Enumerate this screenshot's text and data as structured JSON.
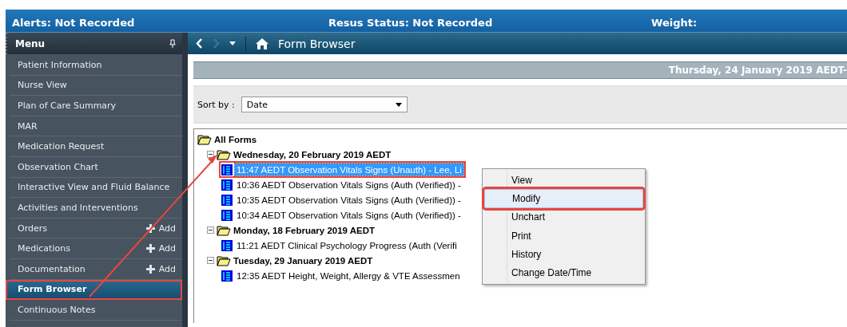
{
  "banner": {
    "alerts": "Alerts: Not Recorded",
    "resus": "Resus Status: Not Recorded",
    "weight": "Weight:"
  },
  "menu_header": {
    "title": "Menu"
  },
  "sidebar": {
    "items": [
      {
        "label": "Patient Information",
        "selected": false,
        "highlighted": false
      },
      {
        "label": "Nurse View",
        "selected": false,
        "highlighted": false
      },
      {
        "label": "Plan of Care Summary",
        "selected": false,
        "highlighted": false
      },
      {
        "label": "MAR",
        "selected": false,
        "highlighted": false
      },
      {
        "label": "Medication Request",
        "selected": false,
        "highlighted": false
      },
      {
        "label": "Observation Chart",
        "selected": false,
        "highlighted": false
      },
      {
        "label": "Interactive View and Fluid Balance",
        "selected": false,
        "highlighted": false
      },
      {
        "label": "Activities and Interventions",
        "selected": false,
        "highlighted": false
      },
      {
        "label": "Orders",
        "add": "Add",
        "selected": false,
        "highlighted": false
      },
      {
        "label": "Medications",
        "add": "Add",
        "selected": false,
        "highlighted": false
      },
      {
        "label": "Documentation",
        "add": "Add",
        "selected": false,
        "highlighted": false
      },
      {
        "label": "Form Browser",
        "selected": true,
        "highlighted": true
      },
      {
        "label": "Continuous Notes",
        "selected": false,
        "highlighted": false
      }
    ]
  },
  "toolbar": {
    "title": "Form Browser"
  },
  "date_bar": "Thursday, 24 January 2019 AEDT-",
  "sort": {
    "label": "Sort by :",
    "value": "Date"
  },
  "tree": {
    "label": "All Forms",
    "children": [
      {
        "label": "Wednesday, 20 February 2019 AEDT",
        "children": [
          {
            "label": "11:47 AEDT Observation Vitals Signs (Unauth) - Lee, Li",
            "selected": true,
            "highlighted": true
          },
          {
            "label": "10:36 AEDT Observation Vitals Signs (Auth (Verified)) -",
            "selected": false,
            "highlighted": false
          },
          {
            "label": "10:35 AEDT Observation Vitals Signs (Auth (Verified)) -",
            "selected": false,
            "highlighted": false
          },
          {
            "label": "10:34 AEDT Observation Vitals Signs (Auth (Verified)) -",
            "selected": false,
            "highlighted": false
          }
        ]
      },
      {
        "label": "Monday, 18 February 2019 AEDT",
        "children": [
          {
            "label": "11:21 AEDT Clinical Psychology Progress (Auth (Verifi",
            "selected": false,
            "highlighted": false
          }
        ]
      },
      {
        "label": "Tuesday, 29 January 2019 AEDT",
        "children": [
          {
            "label": "12:35 AEDT Height, Weight, Allergy & VTE Assessmen",
            "selected": false,
            "highlighted": false
          }
        ]
      }
    ]
  },
  "context_menu": [
    {
      "label": "View",
      "selected": false,
      "highlighted": false
    },
    {
      "label": "Modify",
      "selected": true,
      "highlighted": true
    },
    {
      "label": "Unchart",
      "selected": false,
      "highlighted": false
    },
    {
      "label": "Print",
      "selected": false,
      "highlighted": false
    },
    {
      "label": "History",
      "selected": false,
      "highlighted": false
    },
    {
      "label": "Change Date/Time",
      "selected": false,
      "highlighted": false
    }
  ]
}
